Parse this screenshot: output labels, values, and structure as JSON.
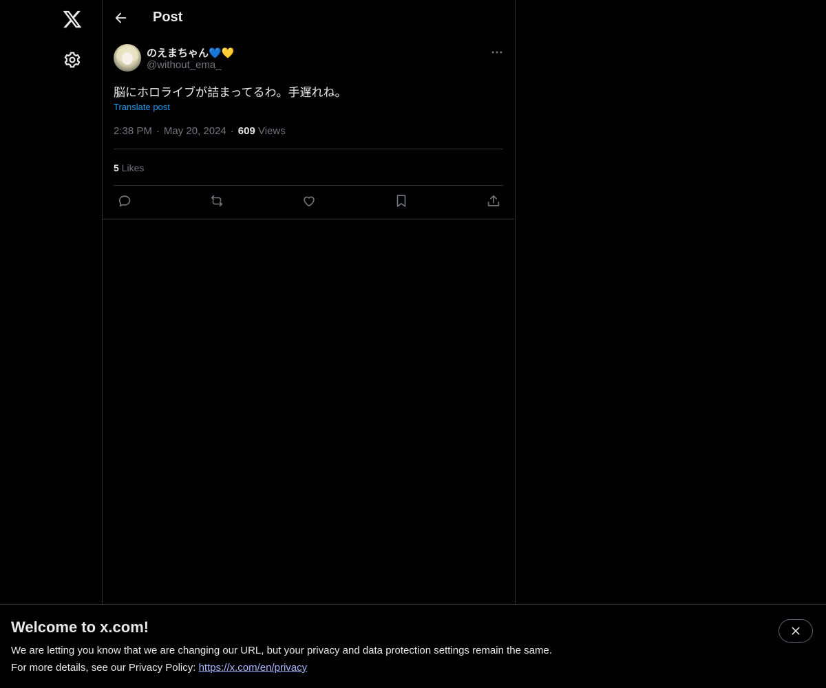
{
  "header": {
    "title": "Post"
  },
  "post": {
    "author": {
      "display_name": "のえまちゃん💙💛",
      "handle": "@without_ema_"
    },
    "text": "脳にホロライブが詰まってるわ。手遅れね。",
    "translate_label": "Translate post",
    "time": "2:38 PM",
    "date": "May 20, 2024",
    "separator": "·",
    "views_count": "609",
    "views_label": "Views",
    "likes_count": "5",
    "likes_label": "Likes"
  },
  "banner": {
    "title": "Welcome to x.com!",
    "line1": "We are letting you know that we are changing our URL, but your privacy and data protection settings remain the same.",
    "line2_prefix": "For more details, see our Privacy Policy: ",
    "link_text": "https://x.com/en/privacy"
  },
  "icons": {
    "logo": "x-logo-icon",
    "settings": "gear-icon",
    "back": "back-arrow-icon",
    "more": "more-icon",
    "reply": "reply-icon",
    "repost": "repost-icon",
    "like": "heart-icon",
    "bookmark": "bookmark-icon",
    "share": "share-icon",
    "close": "close-icon"
  },
  "colors": {
    "background": "#000000",
    "text": "#e7e9ea",
    "muted": "#71767b",
    "accent": "#1d9bf0",
    "border": "#2f3336"
  }
}
